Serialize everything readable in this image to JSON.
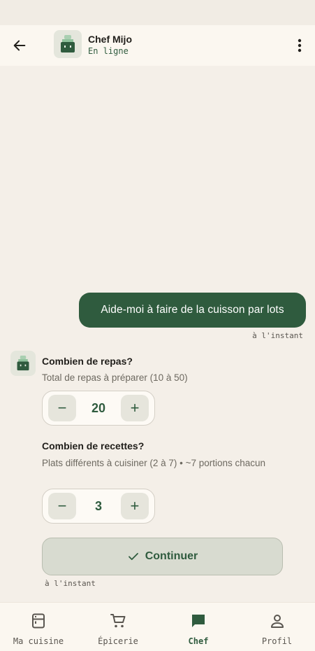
{
  "header": {
    "back_icon": "arrow-left-icon",
    "chef_name": "Chef Mijo",
    "chef_status": "En ligne",
    "menu_icon": "more-vertical-icon"
  },
  "conversation": {
    "user_message": "Aide-moi à faire de la cuisson par lots",
    "user_timestamp": "à l'instant",
    "question1": {
      "title": "Combien de repas?",
      "subtitle": "Total de repas à préparer (10 à 50)",
      "value": "20",
      "decrement": "−",
      "increment": "+"
    },
    "question2": {
      "title": "Combien de recettes?",
      "subtitle": "Plats différents à cuisiner (2 à 7) • ~7 portions chacun",
      "value": "3",
      "decrement": "−",
      "increment": "+"
    },
    "continue_label": "Continuer",
    "bot_timestamp": "à l'instant"
  },
  "bottom_nav": [
    {
      "label": "Ma cuisine",
      "icon": "fridge-icon",
      "active": false
    },
    {
      "label": "Épicerie",
      "icon": "cart-icon",
      "active": false
    },
    {
      "label": "Chef",
      "icon": "chat-icon",
      "active": true
    },
    {
      "label": "Profil",
      "icon": "user-icon",
      "active": false
    }
  ],
  "colors": {
    "accent": "#2f5b3e",
    "background": "#f4efe8",
    "header_bg": "#fbf7f0"
  }
}
